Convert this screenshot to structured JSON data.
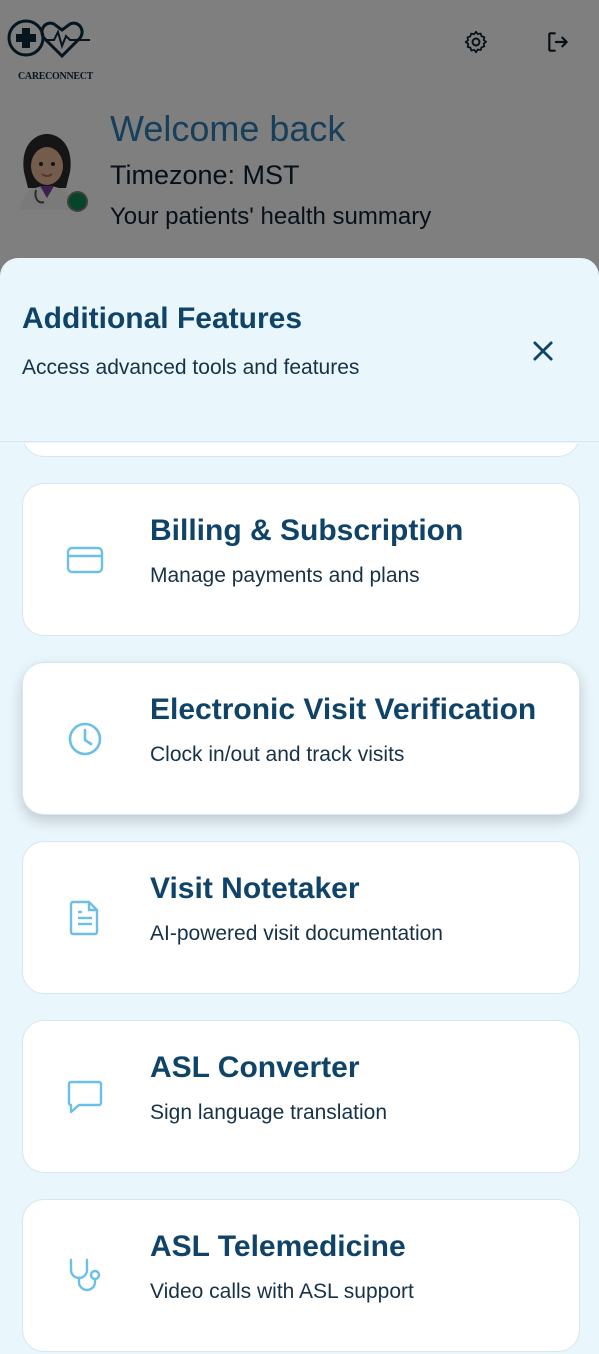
{
  "header": {
    "logo_text": "CARECONNECT",
    "icons": {
      "settings": "gear-icon",
      "logout": "logout-icon"
    }
  },
  "welcome": {
    "greeting": "Welcome back",
    "timezone": "Timezone: MST",
    "summary": "Your patients' health summary"
  },
  "sheet": {
    "title": "Additional Features",
    "subtitle": "Access advanced tools and features",
    "features": [
      {
        "title": "Billing & Subscription",
        "description": "Manage payments and plans",
        "icon": "credit-card-icon"
      },
      {
        "title": "Electronic Visit Verification",
        "description": "Clock in/out and track visits",
        "icon": "clock-icon"
      },
      {
        "title": "Visit Notetaker",
        "description": "AI-powered visit documentation",
        "icon": "document-icon"
      },
      {
        "title": "ASL Converter",
        "description": "Sign language translation",
        "icon": "message-icon"
      },
      {
        "title": "ASL Telemedicine",
        "description": "Video calls with ASL support",
        "icon": "stethoscope-icon"
      }
    ]
  },
  "colors": {
    "accent": "#0f4468",
    "icon": "#6cbfe6",
    "sheet_bg": "#e9f6fc",
    "status_online": "#0d8a4e"
  }
}
